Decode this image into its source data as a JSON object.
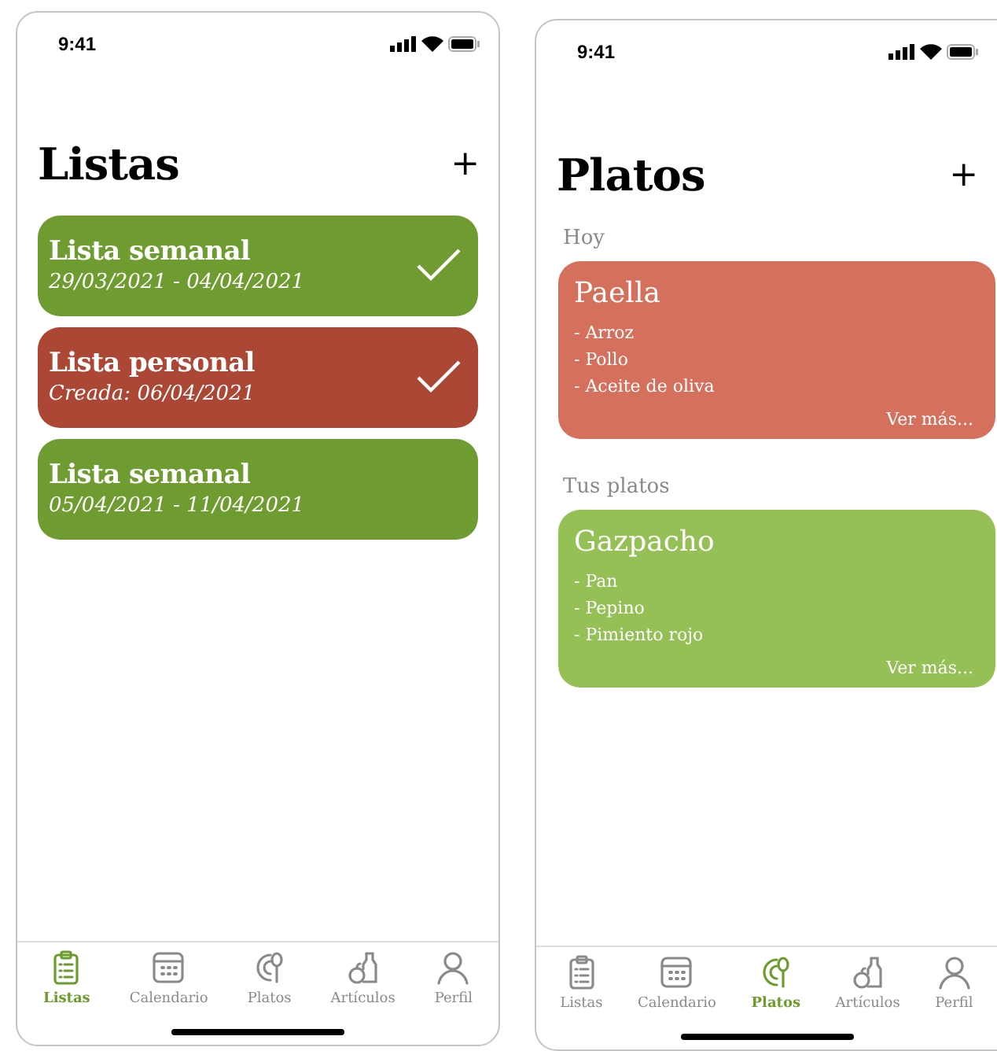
{
  "phones": [
    {
      "kind": "lists",
      "time": "9:41",
      "title": "Listas",
      "add": "+",
      "lists": [
        {
          "name": "Lista semanal",
          "subtitle": "29/03/2021 - 04/04/2021",
          "color": "#6f9c30",
          "done": true
        },
        {
          "name": "Lista personal",
          "subtitle": "Creada: 06/04/2021",
          "color": "#ab4734",
          "done": true
        },
        {
          "name": "Lista semanal",
          "subtitle": "05/04/2021 - 11/04/2021",
          "color": "#6f9c30",
          "done": false
        }
      ],
      "tabs": [
        {
          "label": "Listas",
          "selected": true
        },
        {
          "label": "Calendario",
          "selected": false
        },
        {
          "label": "Platos",
          "selected": false
        },
        {
          "label": "Artículos",
          "selected": false
        },
        {
          "label": "Perfil",
          "selected": false
        }
      ]
    },
    {
      "kind": "dishes",
      "time": "9:41",
      "title": "Platos",
      "add": "+",
      "sections": [
        {
          "heading": "Hoy",
          "dishes": [
            {
              "name": "Paella",
              "items": [
                "- Arroz",
                "- Pollo",
                "- Aceite de oliva"
              ],
              "more": "Ver más...",
              "color": "#d4705c"
            }
          ]
        },
        {
          "heading": "Tus platos",
          "dishes": [
            {
              "name": "Gazpacho",
              "items": [
                "- Pan",
                "- Pepino",
                "- Pimiento rojo"
              ],
              "more": "Ver más...",
              "color": "#94c056"
            }
          ]
        }
      ],
      "tabs": [
        {
          "label": "Listas",
          "selected": false
        },
        {
          "label": "Calendario",
          "selected": false
        },
        {
          "label": "Platos",
          "selected": true
        },
        {
          "label": "Artículos",
          "selected": false
        },
        {
          "label": "Perfil",
          "selected": false
        }
      ]
    }
  ]
}
